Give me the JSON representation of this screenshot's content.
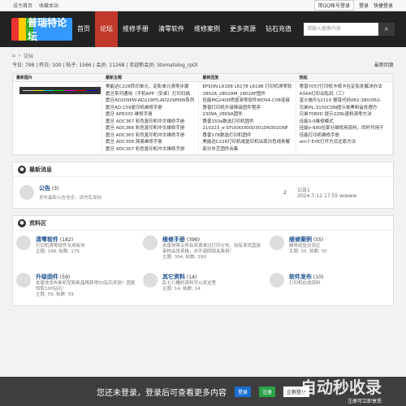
{
  "topbar": {
    "set_home": "设为首页",
    "bookmark": "收藏本站",
    "qq_login": "用QQ帐号登录",
    "login": "登录",
    "fast_login": "快捷登录"
  },
  "nav": {
    "logo": "普瑞特论坛",
    "items": [
      "首页",
      "论坛",
      "维修手册",
      "清零软件",
      "维修案例",
      "更多资源",
      "钻石充值"
    ],
    "search_placeholder": "请输入搜索内容",
    "search_icon": "search-icon"
  },
  "breadcrumb": {
    "home_icon": "home-icon",
    "sep": "›",
    "current": "论坛"
  },
  "stats": {
    "text": "今日: 798 | 昨日: 100 | 帖子: 1566 | 会员: 11268 | 欢迎新会员: Stomatolog_rpOl",
    "latest": "最新回复"
  },
  "latest": {
    "headers": [
      "最新图片",
      "最新主题",
      "最新回复",
      "热帖"
    ],
    "topics": [
      "美能达C226转印单元、定影单元清零步骤",
      "震旦系列通用（手机APP（安卓）打印扫描",
      "震旦AD209PW-AD229PS-AD229PNW系列",
      "震旦AD-159复印机维修手册",
      "震旦 AP8100 维修手册",
      "震旦 ADC367 彩色复印机中文维修手册",
      "震旦 ADC366 彩色复印机中文维修手册",
      "震旦 ADC365 彩色复印机中文维修手册",
      "震旦 ADC358 简易维修手册",
      "震旦 ADC307 彩色复印机中文维修手册"
    ],
    "replies": [
      "EPSON L6168 L6178 L6198 打印机清零软",
      "2802A_2802AM_2802AF固件",
      "佳能MG2400喷墨清零软件WDS4-C08连接",
      "惠普打印机升级降级固件程序",
      "2309A_2809A固件",
      "惠普150a数选打印机固件",
      "210223_e-STUDIO300D301DN302DNF",
      "惠普178数选打印机固件",
      "美能达C226打印机或复印机出现白色线条解",
      "部分东芝固件合集"
    ],
    "hot": [
      "惠普7057打印机卡纸卡在定影处解决办法",
      "A3A4打印动乱码（三）",
      "富士施乐S2110 报错代码062-380/062-",
      "兄弟HL-3150CDN提示单黑粉盒处理方",
      "兄弟7080D 提示228b墨粉清零方法",
      "佳能3-0维修模式",
      "佳能ir-600拉部分维修用资料，同时可用于",
      "佳能打印机维修手册",
      "win7 EXE打开方式还原方法",
      ""
    ]
  },
  "news": {
    "title": "最新消息",
    "forum": "公告",
    "count": "(3)",
    "desc": "发布最新公告信息，请勿乱发帖",
    "pages": "2",
    "last_title": "公告1",
    "last_time": "2024-7-12 17:55 wiwww"
  },
  "resources": {
    "title": "资料区",
    "forums": [
      {
        "name": "清零软件",
        "count": "(182)",
        "desc": "打印机清零软件专用板块",
        "stats": "主题: 149, 帖数: 179"
      },
      {
        "name": "维修手册",
        "count": "(399)",
        "desc": "本版块禁止所有资源单过打印分充，如有发现直接审核会员资格，并不退回相关费用！",
        "stats": "主题: 394, 帖数: 399"
      },
      {
        "name": "维修案例",
        "count": "(55)",
        "desc": "维修经验交流区",
        "stats": "主题: 55, 帖数: 50"
      },
      {
        "name": "升级固件",
        "count": "(59)",
        "desc": "本版块发布新机型和新晶稀获得50钻石奖励！固复知取100钻石！",
        "stats": "主题: 59, 帖数: 59"
      },
      {
        "name": "其它资料",
        "count": "(14)",
        "desc": "乱七八糟的资料可以发这里",
        "stats": "主题: 14, 帖数: 14"
      },
      {
        "name": "软件发布",
        "count": "(10)",
        "desc": "打印机在线资料",
        "stats": ""
      }
    ]
  },
  "bottom": {
    "message": "您还未登录，登录后可查看更多内容",
    "login": "登录",
    "register": "注册",
    "qq": "企鹅登录",
    "watermark": "自动秒收录",
    "watermark_sub": "注册可立即享受"
  }
}
